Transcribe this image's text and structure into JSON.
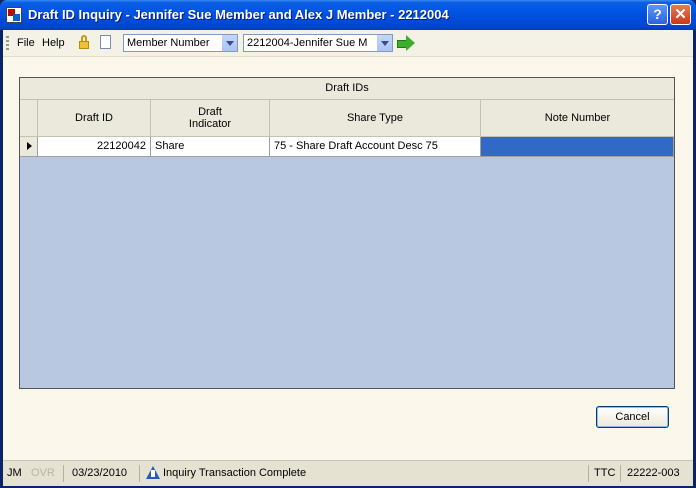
{
  "window": {
    "title": "Draft ID Inquiry - Jennifer Sue Member and Alex J Member - 2212004",
    "help_label": "?",
    "close_label": "✕"
  },
  "toolbar": {
    "menu_file": "File",
    "menu_help": "Help",
    "lookup_type": "Member Number",
    "member_select": "2212004-Jennifer Sue M"
  },
  "grid": {
    "group_header": "Draft IDs",
    "columns": [
      "Draft ID",
      "Draft\nIndicator",
      "Share Type",
      "Note Number"
    ],
    "rows": [
      {
        "draft_id": "22120042",
        "draft_indicator": "Share",
        "share_type": "75 - Share Draft Account Desc 75",
        "note_number": ""
      }
    ]
  },
  "buttons": {
    "cancel": "Cancel"
  },
  "status": {
    "user": "JM",
    "ovr": "OVR",
    "date": "03/23/2010",
    "message": "Inquiry Transaction Complete",
    "ttc": "TTC",
    "code": "22222-003"
  },
  "colors": {
    "title_bar": "#0054e3",
    "selection": "#316ac5",
    "grid_empty": "#b8c8e0"
  }
}
